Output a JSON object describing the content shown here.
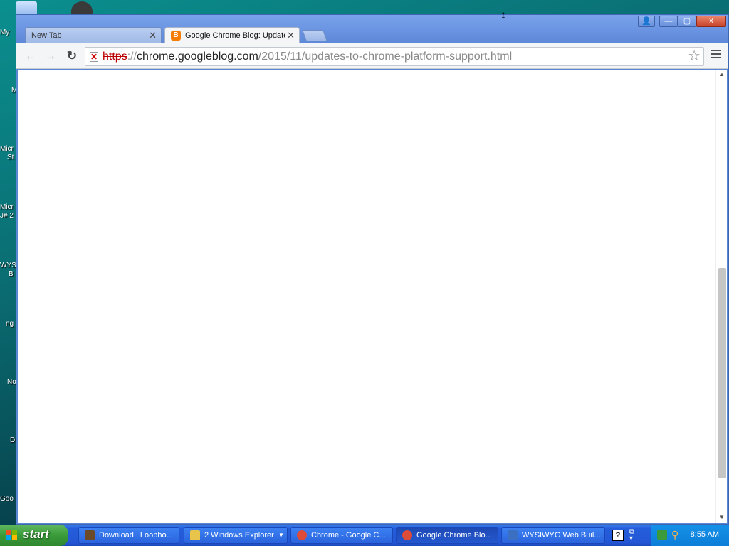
{
  "desktop": {
    "icon_labels": [
      "My",
      "M",
      "Micr",
      "St",
      "Micr",
      "J# 2",
      "WYS",
      "B",
      "ng",
      "No",
      "D",
      "Goo"
    ]
  },
  "browser": {
    "window_buttons": {
      "profile": "👤",
      "minimize": "—",
      "maximize": "▢",
      "close": "X"
    },
    "tabs": [
      {
        "title": "New Tab",
        "active": false
      },
      {
        "title": "Google Chrome Blog: Update",
        "active": true,
        "favicon": "B"
      }
    ],
    "toolbar": {
      "back": "←",
      "forward": "→",
      "reload": "↻",
      "url_scheme": "https",
      "url_sep": "://",
      "url_host": "chrome.googleblog.com",
      "url_path": "/2015/11/updates-to-chrome-platform-support.html",
      "star": "☆"
    }
  },
  "taskbar": {
    "start_label": "start",
    "items": [
      {
        "label": "Download | Loopho...",
        "icon_color": "#6b4a2a"
      },
      {
        "label": "2  Windows Explorer",
        "icon_color": "#e8c44a"
      },
      {
        "label": "Chrome - Google C...",
        "icon_color": "#dd4b39"
      },
      {
        "label": "Google Chrome Blo...",
        "icon_color": "#dd4b39",
        "active": true
      },
      {
        "label": "WYSIWYG Web Buil...",
        "icon_color": "#3a6fc2"
      }
    ],
    "clock": "8:55 AM"
  }
}
